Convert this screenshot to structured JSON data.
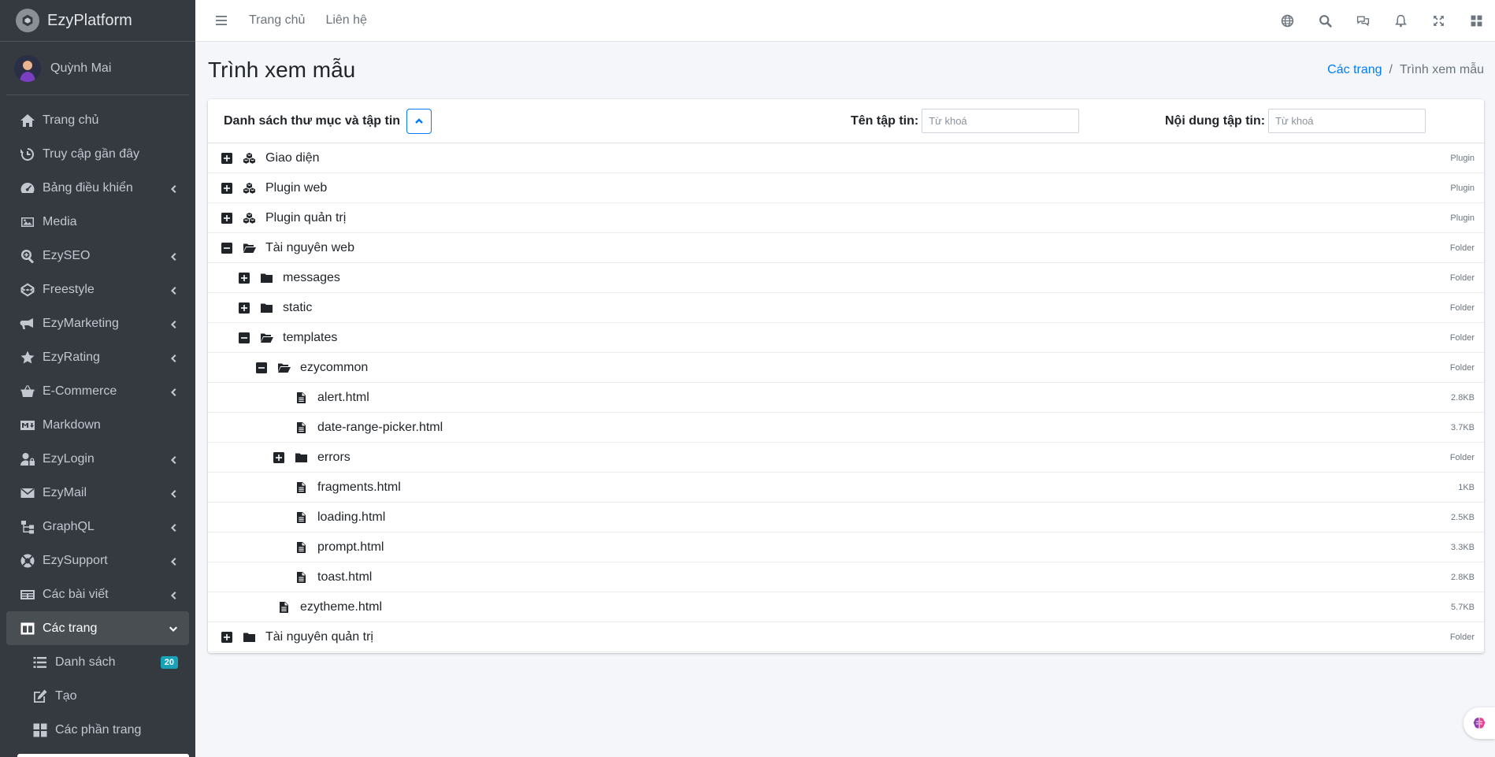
{
  "brand": {
    "name": "EzyPlatform"
  },
  "user": {
    "name": "Quỳnh Mai"
  },
  "sidebar": {
    "items": [
      {
        "label": "Trang chủ",
        "icon": "home-icon",
        "has_children": false
      },
      {
        "label": "Truy cập gần đây",
        "icon": "history-icon",
        "has_children": false
      },
      {
        "label": "Bảng điều khiển",
        "icon": "dashboard-gauge-icon",
        "has_children": true
      },
      {
        "label": "Media",
        "icon": "image-icon",
        "has_children": false
      },
      {
        "label": "EzySEO",
        "icon": "search-plus-icon",
        "has_children": true
      },
      {
        "label": "Freestyle",
        "icon": "codepen-icon",
        "has_children": true
      },
      {
        "label": "EzyMarketing",
        "icon": "bullhorn-icon",
        "has_children": true
      },
      {
        "label": "EzyRating",
        "icon": "star-icon",
        "has_children": true
      },
      {
        "label": "E-Commerce",
        "icon": "basket-icon",
        "has_children": true
      },
      {
        "label": "Markdown",
        "icon": "markdown-icon",
        "has_children": false
      },
      {
        "label": "EzyLogin",
        "icon": "user-lock-icon",
        "has_children": true
      },
      {
        "label": "EzyMail",
        "icon": "envelope-icon",
        "has_children": true
      },
      {
        "label": "GraphQL",
        "icon": "sitemap-icon",
        "has_children": true
      },
      {
        "label": "EzySupport",
        "icon": "life-ring-icon",
        "has_children": true
      },
      {
        "label": "Các bài viết",
        "icon": "newspaper-icon",
        "has_children": true
      },
      {
        "label": "Các trang",
        "icon": "columns-icon",
        "has_children": true,
        "active": true
      }
    ],
    "sub_items": [
      {
        "label": "Danh sách",
        "icon": "list-icon",
        "badge": "20"
      },
      {
        "label": "Tạo",
        "icon": "edit-icon"
      },
      {
        "label": "Các phần trang",
        "icon": "th-large-icon"
      }
    ]
  },
  "topbar": {
    "links": [
      "Trang chủ",
      "Liên hệ"
    ],
    "icons": [
      "globe-icon",
      "search-icon",
      "comments-icon",
      "bell-icon",
      "expand-icon",
      "grid-icon"
    ]
  },
  "header": {
    "title": "Trình xem mẫu",
    "breadcrumb": {
      "link": "Các trang",
      "separator": "/",
      "current": "Trình xem mẫu"
    }
  },
  "card": {
    "title": "Danh sách thư mục và tập tin",
    "filename_filter": {
      "label": "Tên tập tin:",
      "placeholder": "Từ khoá"
    },
    "content_filter": {
      "label": "Nội dung tập tin:",
      "placeholder": "Từ khoá"
    }
  },
  "tree": [
    {
      "name": "Giao diện",
      "type": "plugin",
      "level": 0,
      "state": "collapsed",
      "meta": "Plugin"
    },
    {
      "name": "Plugin web",
      "type": "plugin",
      "level": 0,
      "state": "collapsed",
      "meta": "Plugin"
    },
    {
      "name": "Plugin quản trị",
      "type": "plugin",
      "level": 0,
      "state": "collapsed",
      "meta": "Plugin"
    },
    {
      "name": "Tài nguyên web",
      "type": "folder-open",
      "level": 0,
      "state": "expanded",
      "meta": "Folder"
    },
    {
      "name": "messages",
      "type": "folder",
      "level": 1,
      "state": "collapsed",
      "meta": "Folder"
    },
    {
      "name": "static",
      "type": "folder",
      "level": 1,
      "state": "collapsed",
      "meta": "Folder"
    },
    {
      "name": "templates",
      "type": "folder-open",
      "level": 1,
      "state": "expanded",
      "meta": "Folder"
    },
    {
      "name": "ezycommon",
      "type": "folder-open",
      "level": 2,
      "state": "expanded",
      "meta": "Folder"
    },
    {
      "name": "alert.html",
      "type": "file",
      "level": 3,
      "state": "none",
      "meta": "2.8KB"
    },
    {
      "name": "date-range-picker.html",
      "type": "file",
      "level": 3,
      "state": "none",
      "meta": "3.7KB"
    },
    {
      "name": "errors",
      "type": "folder",
      "level": 3,
      "state": "collapsed",
      "meta": "Folder"
    },
    {
      "name": "fragments.html",
      "type": "file",
      "level": 3,
      "state": "none",
      "meta": "1KB"
    },
    {
      "name": "loading.html",
      "type": "file",
      "level": 3,
      "state": "none",
      "meta": "2.5KB"
    },
    {
      "name": "prompt.html",
      "type": "file",
      "level": 3,
      "state": "none",
      "meta": "3.3KB"
    },
    {
      "name": "toast.html",
      "type": "file",
      "level": 3,
      "state": "none",
      "meta": "2.8KB"
    },
    {
      "name": "ezytheme.html",
      "type": "file",
      "level": 2,
      "state": "none",
      "meta": "5.7KB"
    },
    {
      "name": "Tài nguyên quản trị",
      "type": "folder",
      "level": 0,
      "state": "collapsed",
      "meta": "Folder"
    }
  ],
  "colors": {
    "sidebar_bg": "#343a40",
    "accent": "#007bff",
    "badge": "#17a2b8",
    "page_bg": "#f4f6f9"
  }
}
